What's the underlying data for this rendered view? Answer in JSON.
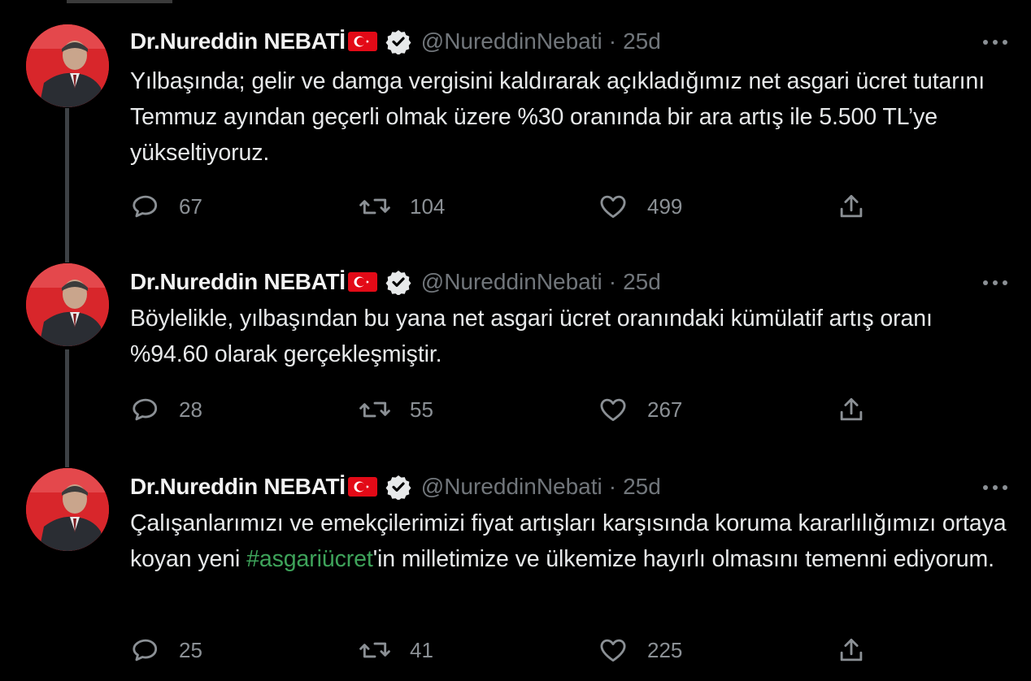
{
  "colors": {
    "background": "#000000",
    "text": "#e7e9ea",
    "muted": "#71767b",
    "hashtag": "#3ea35a",
    "flag_red": "#e30a17",
    "verified": "#e7e9ea"
  },
  "tweets": [
    {
      "display_name": "Dr.Nureddin NEBATİ",
      "handle": "@NureddinNebati",
      "separator": "·",
      "time": "25d",
      "text": "Yılbaşında; gelir ve damga vergisini kaldırarak açıkladığımız net asgari ücret tutarını Temmuz ayından geçerli olmak üzere %30 oranında bir ara artış ile 5.500 TL’ye yükseltiyoruz.",
      "replies": "67",
      "retweets": "104",
      "likes": "499"
    },
    {
      "display_name": "Dr.Nureddin NEBATİ",
      "handle": "@NureddinNebati",
      "separator": "·",
      "time": "25d",
      "text": "Böylelikle, yılbaşından bu yana net asgari ücret oranındaki kümülatif artış oranı %94.60 olarak gerçekleşmiştir.",
      "replies": "28",
      "retweets": "55",
      "likes": "267"
    },
    {
      "display_name": "Dr.Nureddin NEBATİ",
      "handle": "@NureddinNebati",
      "separator": "·",
      "time": "25d",
      "text_before": "Çalışanlarımızı ve emekçilerimizi fiyat artışları karşısında koruma kararlılığımızı ortaya koyan yeni ",
      "hashtag": "#asgariücret",
      "text_after": "'in milletimize ve ülkemize hayırlı olmasını temenni ediyorum.",
      "replies": "25",
      "retweets": "41",
      "likes": "225"
    }
  ],
  "icons": {
    "avatar": "profile-photo",
    "flag": "turkey-flag-icon",
    "verified": "verified-badge-icon",
    "more": "more-options-icon",
    "reply": "reply-icon",
    "retweet": "retweet-icon",
    "like": "heart-icon",
    "share": "share-icon"
  }
}
